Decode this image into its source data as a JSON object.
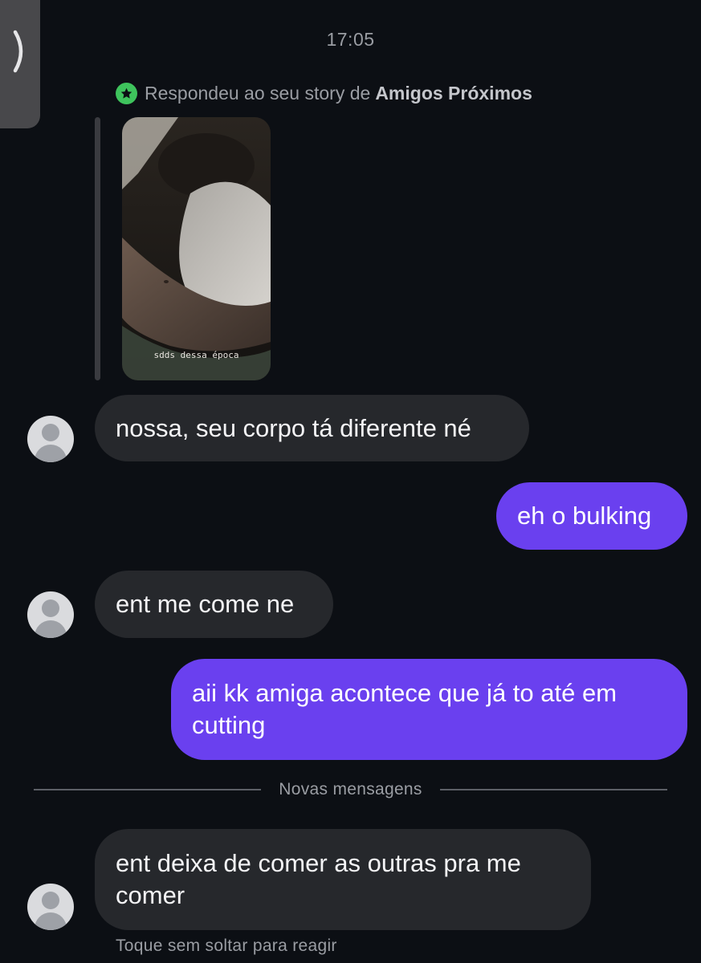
{
  "header": {
    "timestamp": "17:05"
  },
  "story_reply": {
    "prefix": "Respondeu ao seu story de",
    "list_name": "Amigos Próximos",
    "badge_icon": "star-icon",
    "badge_color": "#3ec35c",
    "story_caption": "sdds dessa época"
  },
  "messages": [
    {
      "direction": "incoming",
      "text": "nossa, seu corpo tá diferente né"
    },
    {
      "direction": "outgoing",
      "text": "eh o bulking"
    },
    {
      "direction": "incoming",
      "text": "ent me come ne"
    },
    {
      "direction": "outgoing",
      "text": "aii kk amiga acontece que já to até em cutting"
    },
    {
      "direction": "incoming",
      "text": "ent deixa de comer as outras pra me comer"
    }
  ],
  "divider": {
    "label": "Novas mensagens"
  },
  "footer": {
    "hint": "Toque sem soltar para reagir"
  },
  "colors": {
    "background": "#0c0f14",
    "incoming_bubble": "#26282c",
    "outgoing_bubble": "#6a40ef",
    "muted_text": "#9a9da3"
  }
}
